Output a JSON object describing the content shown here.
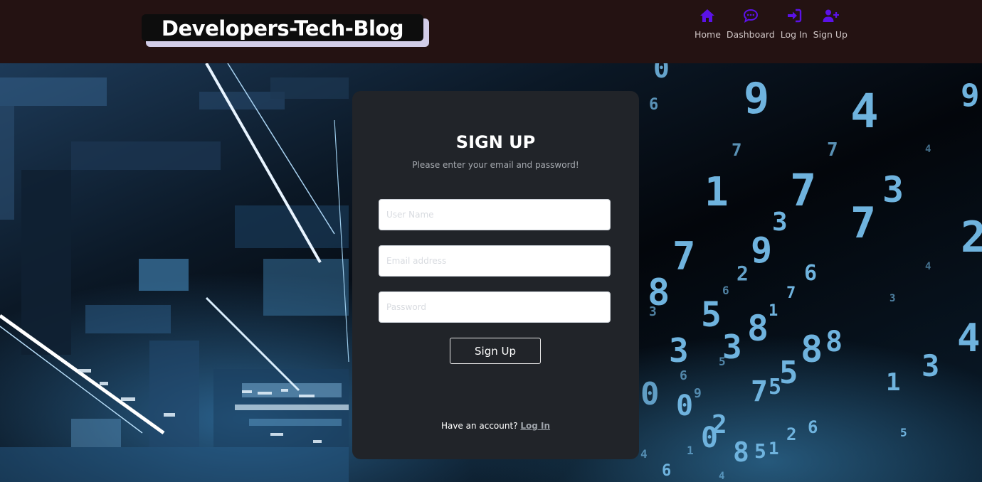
{
  "header": {
    "brand": "Developers-Tech-Blog",
    "nav": [
      {
        "label": "Home",
        "icon": "home-icon"
      },
      {
        "label": "Dashboard",
        "icon": "comment-dots-icon"
      },
      {
        "label": "Log In",
        "icon": "sign-in-icon"
      },
      {
        "label": "Sign Up",
        "icon": "user-plus-icon"
      }
    ],
    "nav_icon_color": "#5b12e8"
  },
  "form": {
    "title": "SIGN UP",
    "subtitle": "Please enter your email and password!",
    "username_placeholder": "User Name",
    "email_placeholder": "Email address",
    "password_placeholder": "Password",
    "submit_label": "Sign Up",
    "account_prompt": "Have an account?",
    "login_link": "Log In"
  },
  "colors": {
    "header_bg": "#241212",
    "card_bg": "#212429",
    "brand_shadow": "#d2cde8"
  },
  "background": {
    "description_icon": "digital-data-background"
  }
}
